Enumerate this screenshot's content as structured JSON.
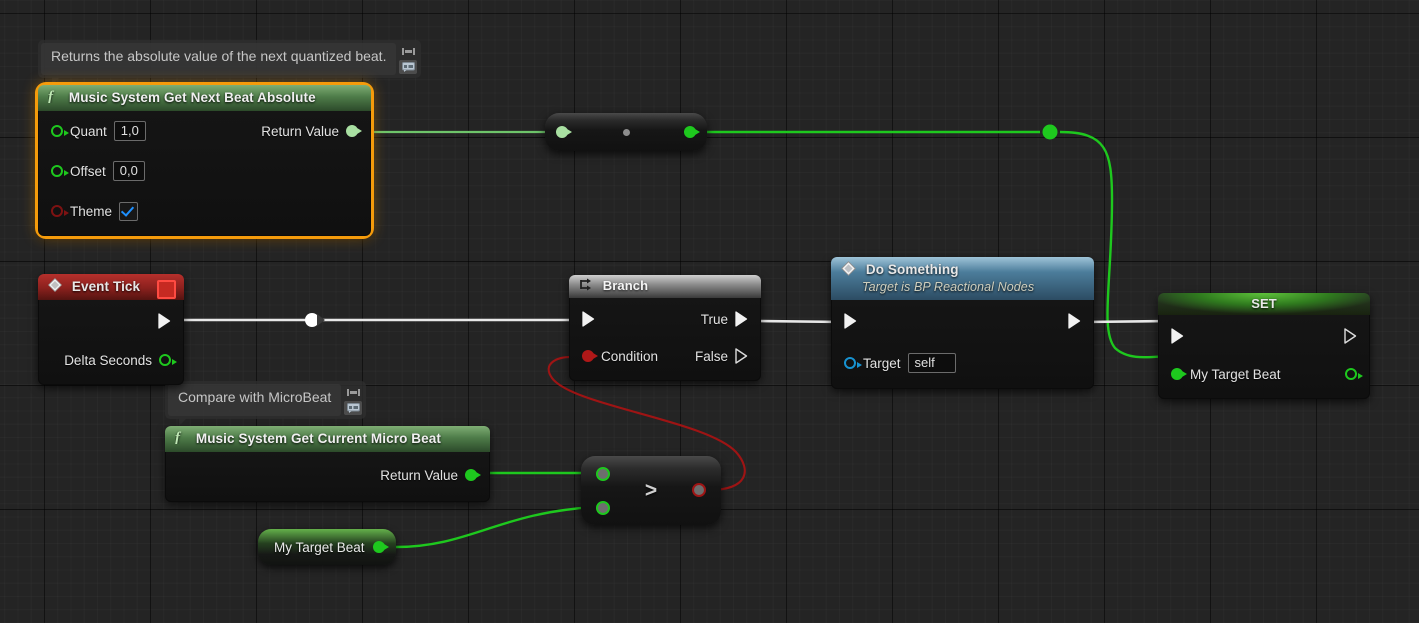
{
  "graph": {
    "background_color": "#242424",
    "grid_minor_color": "#2c2c2c",
    "grid_major_color": "#151515"
  },
  "colors": {
    "exec_wire": "#e8e8e8",
    "float_wire": "#1ec81e",
    "bool_wire": "#9e1414",
    "selection": "#f59b0b",
    "func_header": "#4e7c49",
    "event_header": "#8a201d",
    "flow_header": "#8e8e8e",
    "bp_header": "#4c7d9b",
    "set_header": "#2f7a1e"
  },
  "comments": [
    {
      "id": "comment-next-beat",
      "text": "Returns the absolute value of the next quantized beat.",
      "pin_icon": "pin-icon",
      "bubble_icon": "comment-bubble-icon"
    },
    {
      "id": "comment-microbeat",
      "text": "Compare with MicroBeat",
      "pin_icon": "pin-icon",
      "bubble_icon": "comment-bubble-icon"
    }
  ],
  "nodes": {
    "next_beat_absolute": {
      "title": "Music System Get Next Beat Absolute",
      "icon": "function-icon",
      "selected": true,
      "inputs": [
        {
          "label": "Quant",
          "pin_type": "float",
          "pin_color": "#1ec81e",
          "value": "1,0"
        },
        {
          "label": "Offset",
          "pin_type": "float",
          "pin_color": "#1ec81e",
          "value": "0,0"
        },
        {
          "label": "Theme",
          "pin_type": "bool",
          "pin_color": "#7e1212",
          "value": "checked"
        }
      ],
      "outputs": [
        {
          "label": "Return Value",
          "pin_type": "float",
          "pin_color": "#a9e0a2"
        }
      ]
    },
    "reroute_compact": {
      "title": "",
      "input_pin_color": "#a9e0a2",
      "output_pin_color": "#1ec81e",
      "center_dot_color": "#9a9a9a"
    },
    "event_tick": {
      "title": "Event Tick",
      "icon": "event-diamond-icon",
      "badge": "event-stop-badge",
      "exec_out": "exec",
      "outputs": [
        {
          "label": "Delta Seconds",
          "pin_type": "float",
          "pin_color": "#1ec81e"
        }
      ]
    },
    "branch": {
      "title": "Branch",
      "icon": "branch-icon",
      "inputs": [
        {
          "label": "",
          "pin_type": "exec"
        },
        {
          "label": "Condition",
          "pin_type": "bool",
          "pin_color": "#b01818"
        }
      ],
      "outputs": [
        {
          "label": "True",
          "pin_type": "exec",
          "connected": true
        },
        {
          "label": "False",
          "pin_type": "exec",
          "connected": false
        }
      ]
    },
    "do_something": {
      "title": "Do Something",
      "subtitle": "Target is BP Reactional Nodes",
      "icon": "event-diamond-icon",
      "inputs": [
        {
          "label": "",
          "pin_type": "exec"
        },
        {
          "label": "Target",
          "pin_type": "object",
          "pin_color": "#1792d0",
          "value": "self"
        }
      ],
      "outputs": [
        {
          "label": "",
          "pin_type": "exec"
        }
      ]
    },
    "set_my_target_beat": {
      "title": "SET",
      "inputs": [
        {
          "label": "",
          "pin_type": "exec"
        },
        {
          "label": "My Target Beat",
          "pin_type": "float",
          "pin_color": "#1ec81e"
        }
      ],
      "outputs": [
        {
          "label": "",
          "pin_type": "exec",
          "connected": false
        },
        {
          "label": "",
          "pin_type": "float",
          "pin_color": "#1ec81e",
          "connected": false
        }
      ]
    },
    "current_micro_beat": {
      "title": "Music System Get Current Micro Beat",
      "icon": "function-icon",
      "outputs": [
        {
          "label": "Return Value",
          "pin_type": "float",
          "pin_color": "#1ec81e"
        }
      ]
    },
    "greater_than": {
      "operator": ">",
      "inputs": [
        {
          "pin_type": "float",
          "pin_color": "#1ec81e"
        },
        {
          "pin_type": "float",
          "pin_color": "#1ec81e"
        }
      ],
      "outputs": [
        {
          "pin_type": "bool",
          "pin_color": "#9e1414"
        }
      ]
    },
    "get_my_target_beat": {
      "title": "My Target Beat",
      "pin_color": "#1ec81e"
    }
  }
}
